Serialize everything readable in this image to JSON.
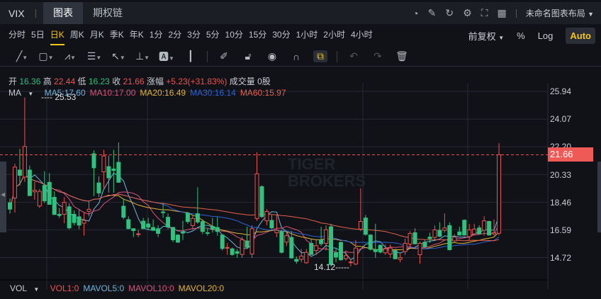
{
  "header": {
    "symbol": "VIX",
    "tabs": [
      "图表",
      "期权链"
    ],
    "active_tab": 0,
    "layout_name": "未命名图表布局",
    "icons": [
      "speedometer-icon",
      "edit-icon",
      "refresh-icon",
      "settings-icon",
      "fullscreen-icon",
      "grid-icon"
    ]
  },
  "timeframes": {
    "items": [
      "分时",
      "5日",
      "日K",
      "周K",
      "月K",
      "季K",
      "年K",
      "1分",
      "2分",
      "3分",
      "5分",
      "10分",
      "15分",
      "30分",
      "1小时",
      "2小时",
      "4小时"
    ],
    "active": 2,
    "adjust": "前复权",
    "percent": "%",
    "log": "Log",
    "auto": "Auto"
  },
  "toolbar": {
    "icons": [
      "trend-line-icon",
      "rectangle-icon",
      "pattern-icon",
      "fibonacci-icon",
      "arrow-icon",
      "measure-icon",
      "text-icon",
      "candle-icon",
      "pencil-icon",
      "lock-icon",
      "eye-icon",
      "magnet-icon",
      "link-icon",
      "undo-icon",
      "redo-icon",
      "trash-icon"
    ]
  },
  "ohlc": {
    "open_label": "开",
    "open": "16.36",
    "high_label": "高",
    "high": "22.44",
    "low_label": "低",
    "low": "16.23",
    "close_label": "收",
    "close": "21.66",
    "change_label": "涨幅",
    "change": "+5.23(+31.83%)",
    "volume_label": "成交量",
    "volume": "0股"
  },
  "ma": {
    "label": "MA",
    "items": [
      {
        "text": "MA5:17.60",
        "color": "#6fb3dc"
      },
      {
        "text": "MA10:17.00",
        "color": "#d9527a"
      },
      {
        "text": "MA20:16.49",
        "color": "#e3b23c"
      },
      {
        "text": "MA30:16.14",
        "color": "#2d62d8"
      },
      {
        "text": "MA60:15.97",
        "color": "#e8604c"
      }
    ]
  },
  "axis": {
    "ticks": [
      "25.94",
      "24.07",
      "22.20",
      "20.33",
      "18.46",
      "16.59",
      "14.72"
    ],
    "last_price": "21.66",
    "high_marker": "25.53",
    "low_marker": "14.12"
  },
  "watermark": [
    "TIGER",
    "BROKERS"
  ],
  "vol": {
    "label": "VOL",
    "items": [
      {
        "text": "VOL1:0",
        "color": "#f0524f"
      },
      {
        "text": "MAVOL5:0",
        "color": "#6fb3dc"
      },
      {
        "text": "MAVOL10:0",
        "color": "#d9527a"
      },
      {
        "text": "MAVOL20:0",
        "color": "#e3b23c"
      }
    ]
  },
  "colors": {
    "up": "#f0524f",
    "down": "#2ec27e",
    "accent": "#f5c518"
  },
  "chart_data": {
    "type": "candlestick",
    "ylim": [
      13.8,
      26.3
    ],
    "fields": [
      "open",
      "high",
      "low",
      "close"
    ],
    "candles": [
      [
        18.42,
        18.71,
        17.68,
        17.99
      ],
      [
        18.74,
        21.06,
        17.75,
        20.83
      ],
      [
        20.63,
        22.06,
        19.59,
        20.27
      ],
      [
        20.15,
        25.53,
        19.83,
        22.22
      ],
      [
        20.63,
        20.94,
        18.9,
        18.9
      ],
      [
        19.16,
        19.83,
        18.63,
        19.27
      ],
      [
        18.2,
        19.35,
        18.07,
        19.19
      ],
      [
        19.59,
        20.55,
        18.4,
        18.55
      ],
      [
        19.8,
        20.42,
        18.31,
        18.31
      ],
      [
        18.79,
        19.19,
        17.6,
        17.63
      ],
      [
        17.64,
        18.07,
        17.39,
        17.56
      ],
      [
        17.64,
        18.79,
        17.04,
        18.44
      ],
      [
        18.15,
        18.39,
        16.64,
        16.72
      ],
      [
        17.64,
        17.9,
        16.9,
        17.08
      ],
      [
        17.47,
        18.0,
        16.64,
        16.91
      ],
      [
        17.04,
        17.8,
        16.2,
        17.23
      ],
      [
        17.84,
        18.5,
        17.5,
        17.98
      ],
      [
        21.73,
        21.96,
        18.87,
        20.78
      ],
      [
        19.76,
        20.2,
        18.8,
        19.08
      ],
      [
        20.51,
        22.0,
        19.4,
        21.58
      ],
      [
        20.86,
        21.6,
        19.1,
        20.1
      ],
      [
        20.7,
        22.0,
        19.1,
        20.6
      ],
      [
        21.15,
        22.49,
        19.8,
        19.8
      ],
      [
        18.19,
        18.7,
        17.3,
        17.44
      ],
      [
        17.28,
        17.5,
        16.64,
        16.67
      ],
      [
        16.67,
        16.7,
        16.1,
        16.54
      ],
      [
        16.29,
        16.6,
        16.1,
        16.32
      ],
      [
        17.18,
        17.4,
        16.64,
        16.67
      ],
      [
        16.99,
        17.4,
        16.6,
        16.77
      ],
      [
        16.75,
        17.3,
        16.5,
        16.56
      ],
      [
        16.67,
        16.9,
        16.1,
        16.35
      ],
      [
        17.8,
        18.4,
        17.4,
        17.75
      ],
      [
        17.44,
        17.7,
        16.64,
        16.78
      ],
      [
        16.75,
        16.8,
        15.76,
        15.92
      ],
      [
        16.24,
        16.3,
        15.7,
        15.76
      ],
      [
        16.44,
        17.2,
        15.9,
        16.37
      ],
      [
        17.72,
        17.8,
        17.0,
        17.15
      ],
      [
        16.88,
        17.6,
        16.6,
        17.36
      ],
      [
        17.68,
        19.47,
        17.0,
        17.12
      ],
      [
        17.15,
        17.3,
        16.3,
        16.48
      ],
      [
        16.4,
        16.7,
        16.2,
        16.38
      ],
      [
        16.83,
        17.4,
        16.4,
        16.64
      ],
      [
        16.75,
        17.46,
        16.2,
        16.48
      ],
      [
        16.24,
        16.3,
        15.2,
        15.33
      ],
      [
        15.36,
        15.7,
        14.9,
        15.4
      ],
      [
        15.31,
        15.4,
        14.85,
        14.92
      ],
      [
        15.12,
        15.3,
        14.7,
        15.01
      ],
      [
        14.93,
        16.1,
        14.7,
        15.92
      ],
      [
        15.84,
        16.8,
        15.3,
        15.41
      ],
      [
        14.96,
        16.9,
        14.7,
        16.67
      ],
      [
        17.36,
        21.83,
        17.2,
        20.37
      ],
      [
        19.51,
        19.6,
        17.4,
        17.48
      ],
      [
        17.2,
        18.0,
        16.9,
        17.83
      ],
      [
        17.23,
        17.6,
        16.64,
        16.72
      ],
      [
        16.4,
        17.6,
        16.1,
        16.56
      ],
      [
        16.48,
        16.6,
        15.0,
        15.07
      ],
      [
        15.76,
        16.4,
        15.5,
        16.2
      ],
      [
        16.08,
        16.5,
        14.65,
        14.69
      ],
      [
        14.6,
        14.8,
        14.3,
        14.47
      ],
      [
        14.6,
        15.3,
        14.4,
        14.82
      ],
      [
        14.37,
        15.3,
        14.3,
        15.07
      ],
      [
        15.68,
        16.0,
        14.9,
        14.93
      ],
      [
        15.2,
        15.9,
        14.9,
        15.52
      ],
      [
        15.92,
        16.8,
        15.5,
        15.65
      ],
      [
        15.68,
        16.9,
        15.2,
        16.6
      ],
      [
        16.8,
        17.0,
        14.12,
        14.25
      ],
      [
        15.04,
        15.3,
        14.4,
        14.75
      ],
      [
        15.74,
        15.8,
        14.5,
        14.57
      ],
      [
        14.65,
        15.2,
        14.5,
        14.85
      ],
      [
        14.4,
        14.6,
        14.12,
        14.42
      ],
      [
        14.28,
        15.9,
        14.2,
        15.36
      ],
      [
        16.64,
        19.4,
        16.5,
        17.16
      ],
      [
        17.39,
        17.6,
        16.2,
        16.29
      ],
      [
        16.24,
        16.3,
        15.2,
        15.28
      ],
      [
        15.25,
        17.0,
        14.7,
        15.12
      ],
      [
        15.55,
        15.6,
        15.0,
        15.09
      ],
      [
        15.04,
        15.6,
        14.9,
        15.31
      ],
      [
        14.96,
        15.6,
        14.7,
        15.36
      ],
      [
        15.19,
        15.3,
        14.6,
        14.64
      ],
      [
        14.6,
        15.0,
        14.4,
        14.72
      ],
      [
        15.12,
        16.0,
        14.9,
        15.68
      ],
      [
        15.63,
        16.5,
        15.4,
        16.35
      ],
      [
        16.4,
        16.7,
        15.6,
        15.65
      ],
      [
        14.91,
        15.8,
        14.3,
        15.68
      ],
      [
        15.76,
        15.9,
        15.4,
        15.44
      ],
      [
        16.1,
        16.4,
        15.7,
        16.0
      ],
      [
        16.08,
        16.9,
        15.9,
        16.59
      ],
      [
        16.56,
        17.1,
        16.1,
        16.16
      ],
      [
        16.56,
        17.7,
        16.4,
        16.72
      ],
      [
        16.88,
        17.1,
        15.2,
        15.25
      ],
      [
        15.84,
        16.3,
        15.7,
        16.11
      ],
      [
        16.45,
        16.8,
        16.2,
        16.24
      ],
      [
        17.24,
        17.3,
        16.2,
        16.24
      ],
      [
        16.13,
        17.0,
        15.9,
        16.59
      ],
      [
        16.32,
        17.0,
        16.2,
        16.64
      ],
      [
        16.72,
        16.9,
        16.3,
        16.32
      ],
      [
        16.56,
        17.5,
        16.2,
        17.2
      ],
      [
        17.16,
        17.2,
        16.2,
        16.24
      ],
      [
        16.32,
        17.3,
        16.2,
        16.4
      ],
      [
        16.36,
        22.44,
        16.23,
        21.66
      ]
    ]
  }
}
